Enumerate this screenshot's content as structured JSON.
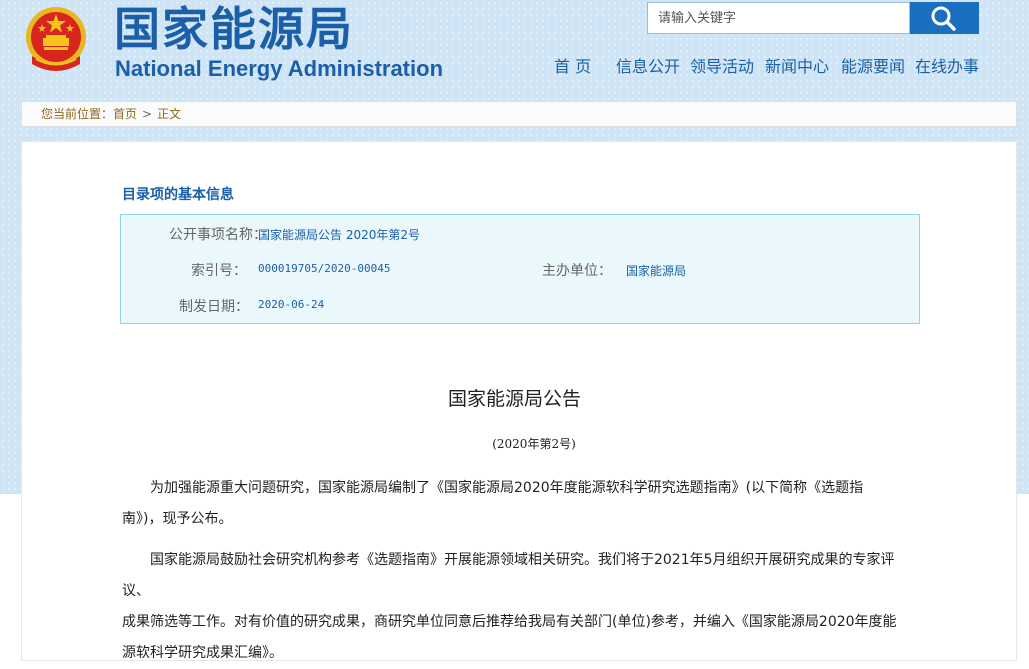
{
  "header": {
    "title_cn": "国家能源局",
    "title_en": "National Energy Administration",
    "search_placeholder": "请输入关键字",
    "icons": {
      "emblem": "national-emblem-icon",
      "search": "search-icon"
    },
    "colors": {
      "brand": "#1b5fa8",
      "search_button": "#1a6fc0",
      "background": "#cfe5f5"
    }
  },
  "nav": {
    "items": [
      "首 页",
      "信息公开",
      "领导活动",
      "新闻中心",
      "能源要闻",
      "在线办事"
    ]
  },
  "breadcrumb": {
    "prefix": "您当前位置：",
    "home": "首页",
    "separator": ">",
    "current": "正文"
  },
  "catalog": {
    "title": "目录项的基本信息",
    "name_label": "公开事项名称：",
    "name_value": "国家能源局公告 2020年第2号",
    "index_label": "索引号：",
    "index_value": "000019705/2020-00045",
    "unit_label": "主办单位：",
    "unit_value": "国家能源局",
    "date_label": "制发日期：",
    "date_value": "2020-06-24"
  },
  "article": {
    "title": "国家能源局公告",
    "subtitle": "(2020年第2号)",
    "para1_line1": "为加强能源重大问题研究，国家能源局编制了《国家能源局2020年度能源软科学研究选题指南》(以下简称《选题指",
    "para1_line2": "南》)，现予公布。",
    "para2_line1": "国家能源局鼓励社会研究机构参考《选题指南》开展能源领域相关研究。我们将于2021年5月组织开展研究成果的专家评议、",
    "para2_line2": "成果筛选等工作。对有价值的研究成果，商研究单位同意后推荐给我局有关部门(单位)参考，并编入《国家能源局2020年度能",
    "para2_line3": "源软科学研究成果汇编》。"
  }
}
